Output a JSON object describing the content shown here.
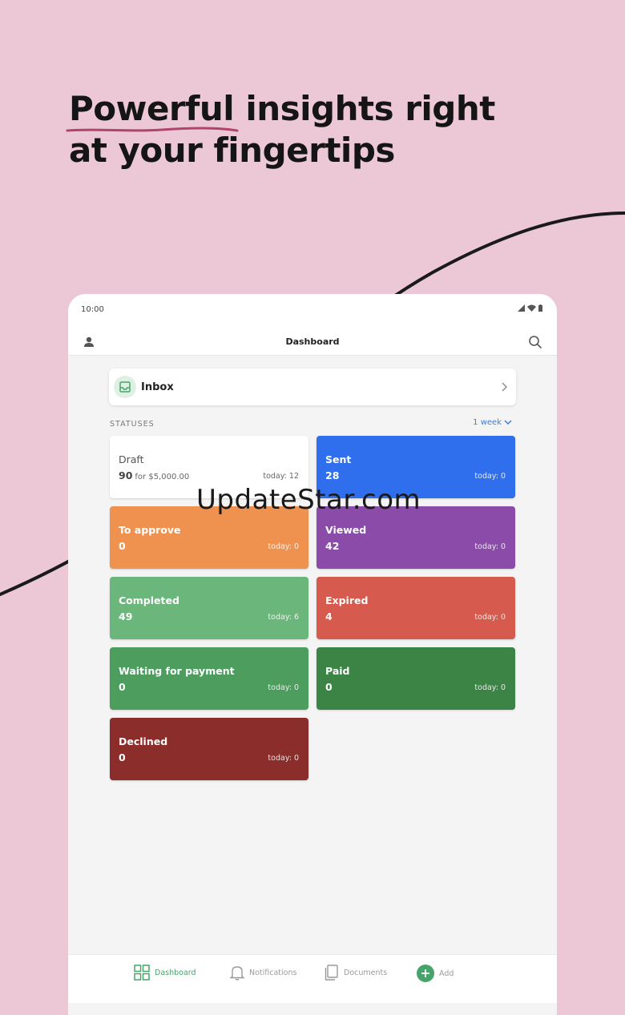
{
  "headline": {
    "line1_underlined": "Powerful",
    "line1_rest": " insights right",
    "line2": "at your fingertips"
  },
  "device": {
    "status_time": "10:00",
    "app_title": "Dashboard"
  },
  "inbox": {
    "label": "Inbox"
  },
  "statuses": {
    "header": "STATUSES",
    "period": "1 week",
    "cards": [
      {
        "name": "Draft",
        "count": "90",
        "amount": "for $5,000.00",
        "today": "today: 12",
        "color": "#FFFFFF"
      },
      {
        "name": "Sent",
        "count": "28",
        "today": "today: 0",
        "color": "#2F6FED"
      },
      {
        "name": "To approve",
        "count": "0",
        "today": "today: 0",
        "color": "#F0924F"
      },
      {
        "name": "Viewed",
        "count": "42",
        "today": "today: 0",
        "color": "#8A4CA8"
      },
      {
        "name": "Completed",
        "count": "49",
        "today": "today: 6",
        "color": "#6BB77B"
      },
      {
        "name": "Expired",
        "count": "4",
        "today": "today: 0",
        "color": "#D65A4D"
      },
      {
        "name": "Waiting for payment",
        "count": "0",
        "today": "today: 0",
        "color": "#4C9D5E"
      },
      {
        "name": "Paid",
        "count": "0",
        "today": "today: 0",
        "color": "#3C8446"
      },
      {
        "name": "Declined",
        "count": "0",
        "today": "today: 0",
        "color": "#8B2D2A"
      }
    ]
  },
  "bottom_nav": {
    "dashboard": "Dashboard",
    "notifications": "Notifications",
    "documents": "Documents",
    "add": "Add"
  },
  "colors": {
    "background": "#ECC8D6",
    "accent_green": "#46A36A",
    "link_blue": "#3B7BE0",
    "underline": "#B0446A"
  },
  "watermark": "UpdateStar.com"
}
